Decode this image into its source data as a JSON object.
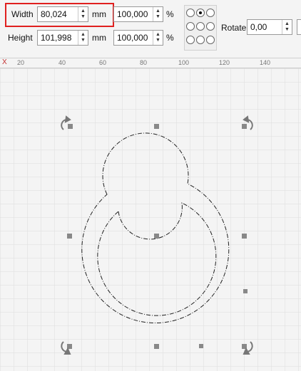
{
  "toolbar": {
    "width_label": "Width",
    "width_value": "80,024",
    "width_unit": "mm",
    "width_percent": "100,000",
    "width_percent_unit": "%",
    "height_label": "Height",
    "height_value": "101,998",
    "height_unit": "mm",
    "height_percent": "100,000",
    "height_percent_unit": "%",
    "rotate_label": "Rotate",
    "rotate_value": "0,00",
    "position_selected": "top-center"
  },
  "ruler": {
    "axis_label": "X",
    "ticks": [
      "20",
      "40",
      "60",
      "80",
      "100",
      "120",
      "140"
    ]
  },
  "colors": {
    "highlight": "#e0201f",
    "grid": "#dddddd",
    "handle": "#888888"
  },
  "icons": [
    "rotate-handle-icon",
    "scale-handle-icon",
    "chevron-up-icon",
    "chevron-down-icon"
  ]
}
